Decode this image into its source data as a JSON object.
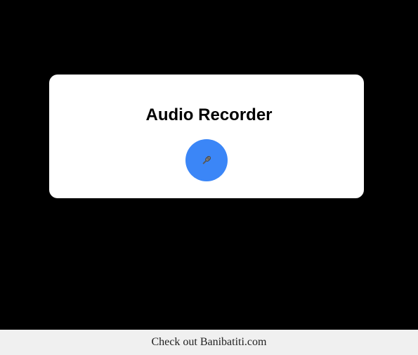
{
  "recorder": {
    "title": "Audio Recorder",
    "mic_icon": "microphone-icon",
    "button_color": "#3b86f7"
  },
  "footer": {
    "prefix": "Check out",
    "link_text": "Banibatiti.com"
  }
}
